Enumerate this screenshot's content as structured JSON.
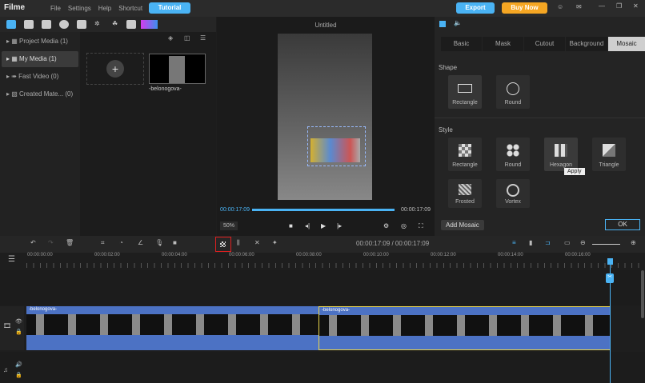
{
  "app": {
    "name": "Filme",
    "menu": [
      "File",
      "Settings",
      "Help",
      "Shortcut"
    ],
    "tutorial": "Tutorial",
    "export": "Export",
    "buy_now": "Buy Now"
  },
  "left_nav": [
    {
      "label": "Project Media (1)"
    },
    {
      "label": "My Media (1)",
      "selected": true
    },
    {
      "label": "Fast Video (0)"
    },
    {
      "label": "Created Mate... (0)"
    }
  ],
  "media": {
    "items": [
      {
        "name": "-belonogova-"
      }
    ]
  },
  "preview": {
    "title": "Untitled",
    "current_time": "00:00:17:09",
    "total_time": "00:00:17:09",
    "zoom": "50%",
    "progress": 1.0
  },
  "right_panel": {
    "tabs": [
      "Basic",
      "Mask",
      "Cutout",
      "Background",
      "Mosaic"
    ],
    "active_tab": "Mosaic",
    "shape_label": "Shape",
    "shapes": [
      "Rectangle",
      "Round"
    ],
    "style_label": "Style",
    "styles": [
      "Rectangle",
      "Round",
      "Hexagon",
      "Triangle",
      "Frosted",
      "Vortex"
    ],
    "tooltip": "Apply",
    "add_mosaic": "Add Mosaic",
    "ok": "OK"
  },
  "timeline": {
    "timecode": "00:00:17:09 / 00:00:17:09",
    "ruler": [
      "00:00:00:00",
      "00:00:02:00",
      "00:00:04:00",
      "00:00:06:00",
      "00:00:08:00",
      "00:00:10:00",
      "00:00:12:00",
      "00:00:14:00",
      "00:00:16:00"
    ],
    "clips": [
      {
        "name": "-belonogova-"
      },
      {
        "name": "-belonogova-"
      }
    ]
  },
  "colors": {
    "accent": "#4ab3f4",
    "buy": "#f5a623",
    "clip": "#4c72c4",
    "selected_clip_border": "#e8d44d"
  }
}
